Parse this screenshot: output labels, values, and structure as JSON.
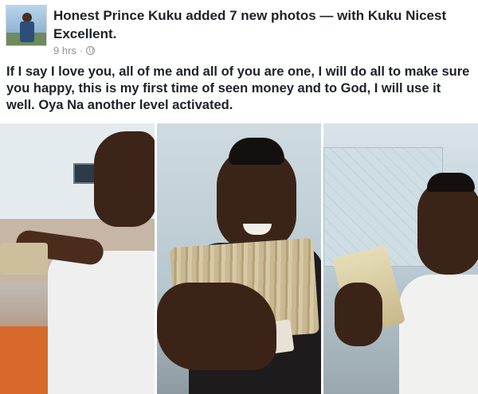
{
  "post": {
    "author": "Honest Prince Kuku",
    "action": "added 7 new photos — with",
    "tagged": "Kuku Nicest Excellent.",
    "time": "9 hrs",
    "separator": "·",
    "privacy_icon": "globe-icon",
    "text": "If I say I love you, all of me and all of you are one, I will do all to make sure you happy, this is my first time of seen money and to God, I will use it well. Oya Na another level activated."
  },
  "photos": [
    {
      "label": "photo-1"
    },
    {
      "label": "photo-2"
    },
    {
      "label": "photo-3"
    }
  ],
  "colors": {
    "text": "#1d2129",
    "meta": "#90949c",
    "background": "#ffffff"
  }
}
